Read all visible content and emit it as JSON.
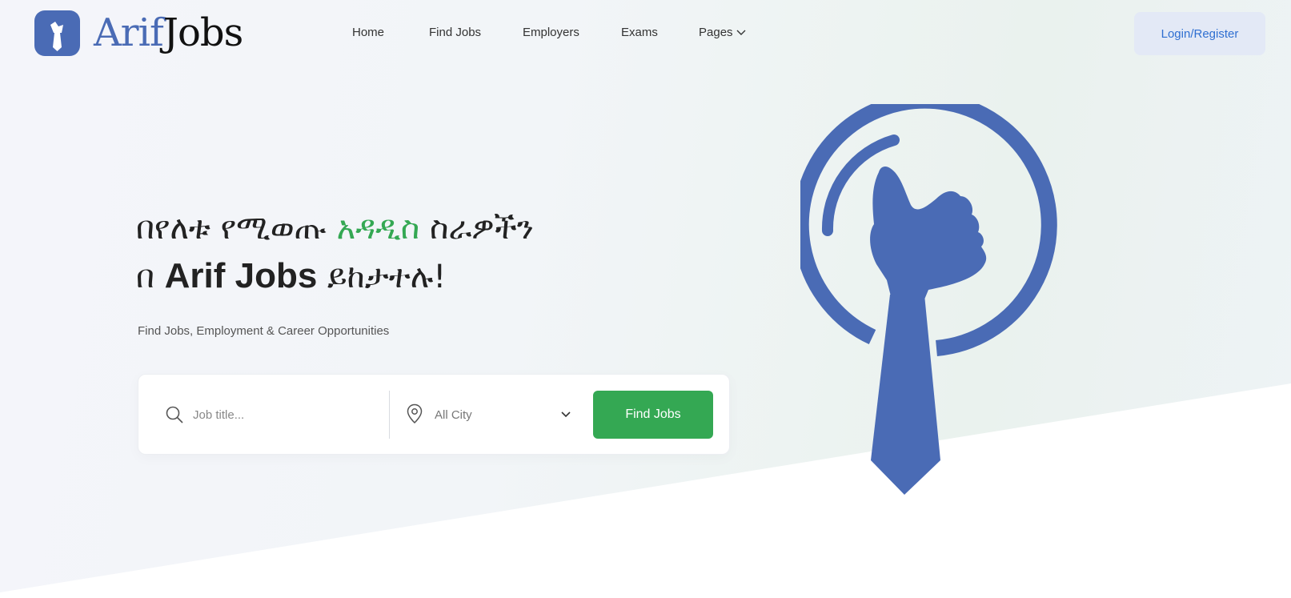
{
  "header": {
    "logo": {
      "text_part1": "Arif",
      "text_part2": "Jobs",
      "brand_color": "#4a6bb5"
    },
    "nav": [
      {
        "label": "Home"
      },
      {
        "label": "Find Jobs"
      },
      {
        "label": "Employers"
      },
      {
        "label": "Exams"
      },
      {
        "label": "Pages"
      }
    ],
    "login_label": "Login/Register"
  },
  "hero": {
    "line1_part1": "በየለቱ የሚወጡ ",
    "line1_highlight": "አዳዲስ",
    "line1_part2": " ስራዎችን",
    "line2_part1": "በ ",
    "line2_brand": "Arif Jobs",
    "line2_part2": " ይከታተሉ!",
    "subtitle": "Find Jobs, Employment & Career Opportunities",
    "highlight_color": "#34a853"
  },
  "search": {
    "job_placeholder": "Job title...",
    "city_value": "All City",
    "button_label": "Find Jobs",
    "button_color": "#34a853"
  },
  "icons": {
    "search": "search-icon",
    "location": "location-pin-icon",
    "chevron": "chevron-down-icon",
    "illustration": "thumbs-up-tie-icon"
  }
}
